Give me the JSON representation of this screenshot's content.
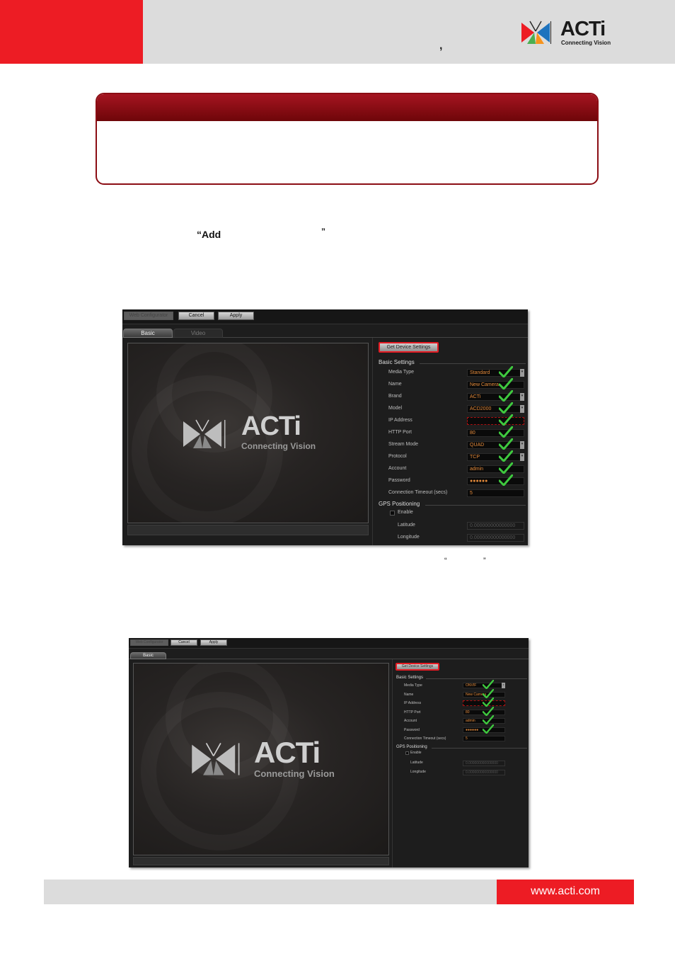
{
  "header": {
    "comma": ",",
    "logo_word": "ACTi",
    "logo_sub": "Connecting Vision"
  },
  "body": {
    "quote_open": "“Add",
    "quote_close": "”",
    "caption_quote_open": "“",
    "caption_quote_close": "”"
  },
  "shot1": {
    "toolbar": [
      "Web Configurator",
      "Cancel",
      "Apply"
    ],
    "tabs": [
      "Basic",
      "Video"
    ],
    "preview_logo": "ACTi",
    "preview_sub": "Connecting Vision",
    "get_settings": "Get Device Settings",
    "basic_title": "Basic Settings",
    "fields": [
      {
        "label": "Media Type",
        "value": "Standard",
        "kind": "select"
      },
      {
        "label": "Name",
        "value": "New Camera",
        "kind": "text"
      },
      {
        "label": "Brand",
        "value": "ACTi",
        "kind": "select"
      },
      {
        "label": "Model",
        "value": "ACD2000",
        "kind": "select"
      },
      {
        "label": "IP Address",
        "value": "",
        "kind": "text"
      },
      {
        "label": "HTTP Port",
        "value": "80",
        "kind": "text"
      },
      {
        "label": "Stream Mode",
        "value": "QUAD",
        "kind": "select"
      },
      {
        "label": "Protocol",
        "value": "TCP",
        "kind": "select"
      },
      {
        "label": "Account",
        "value": "admin",
        "kind": "text"
      },
      {
        "label": "Password",
        "value": "●●●●●●",
        "kind": "text"
      },
      {
        "label": "Connection Timeout (secs)",
        "value": "5",
        "kind": "text"
      }
    ],
    "gps_title": "GPS Positioning",
    "enable_label": "Enable",
    "latitude_label": "Latitude",
    "latitude_value": "0.000000000000000",
    "longitude_label": "Longitude",
    "longitude_value": "0.000000000000000"
  },
  "shot2": {
    "toolbar": [
      "Web Configurator",
      "Cancel",
      "Apply"
    ],
    "tabs": [
      "Basic"
    ],
    "preview_logo": "ACTi",
    "preview_sub": "Connecting Vision",
    "get_settings": "Get Device Settings",
    "basic_title": "Basic Settings",
    "fields": [
      {
        "label": "Media Type",
        "value": "ONVIF",
        "kind": "select"
      },
      {
        "label": "Name",
        "value": "New Camera",
        "kind": "text"
      },
      {
        "label": "IP Address",
        "value": "",
        "kind": "text"
      },
      {
        "label": "HTTP Port",
        "value": "80",
        "kind": "text"
      },
      {
        "label": "Account",
        "value": "admin",
        "kind": "text"
      },
      {
        "label": "Password",
        "value": "●●●●●●",
        "kind": "text"
      },
      {
        "label": "Connection Timeout (secs)",
        "value": "5",
        "kind": "text"
      }
    ],
    "gps_title": "GPS Positioning",
    "enable_label": "Enable",
    "latitude_label": "Latitude",
    "latitude_value": "0.000000000000000",
    "longitude_label": "Longitude",
    "longitude_value": "0.000000000000000"
  },
  "footer": {
    "url": "www.acti.com"
  },
  "colors": {
    "brand_red": "#ed1c24",
    "note_red": "#8b0d14",
    "field_text": "#e48a3a",
    "check_green": "#3fc93f"
  }
}
